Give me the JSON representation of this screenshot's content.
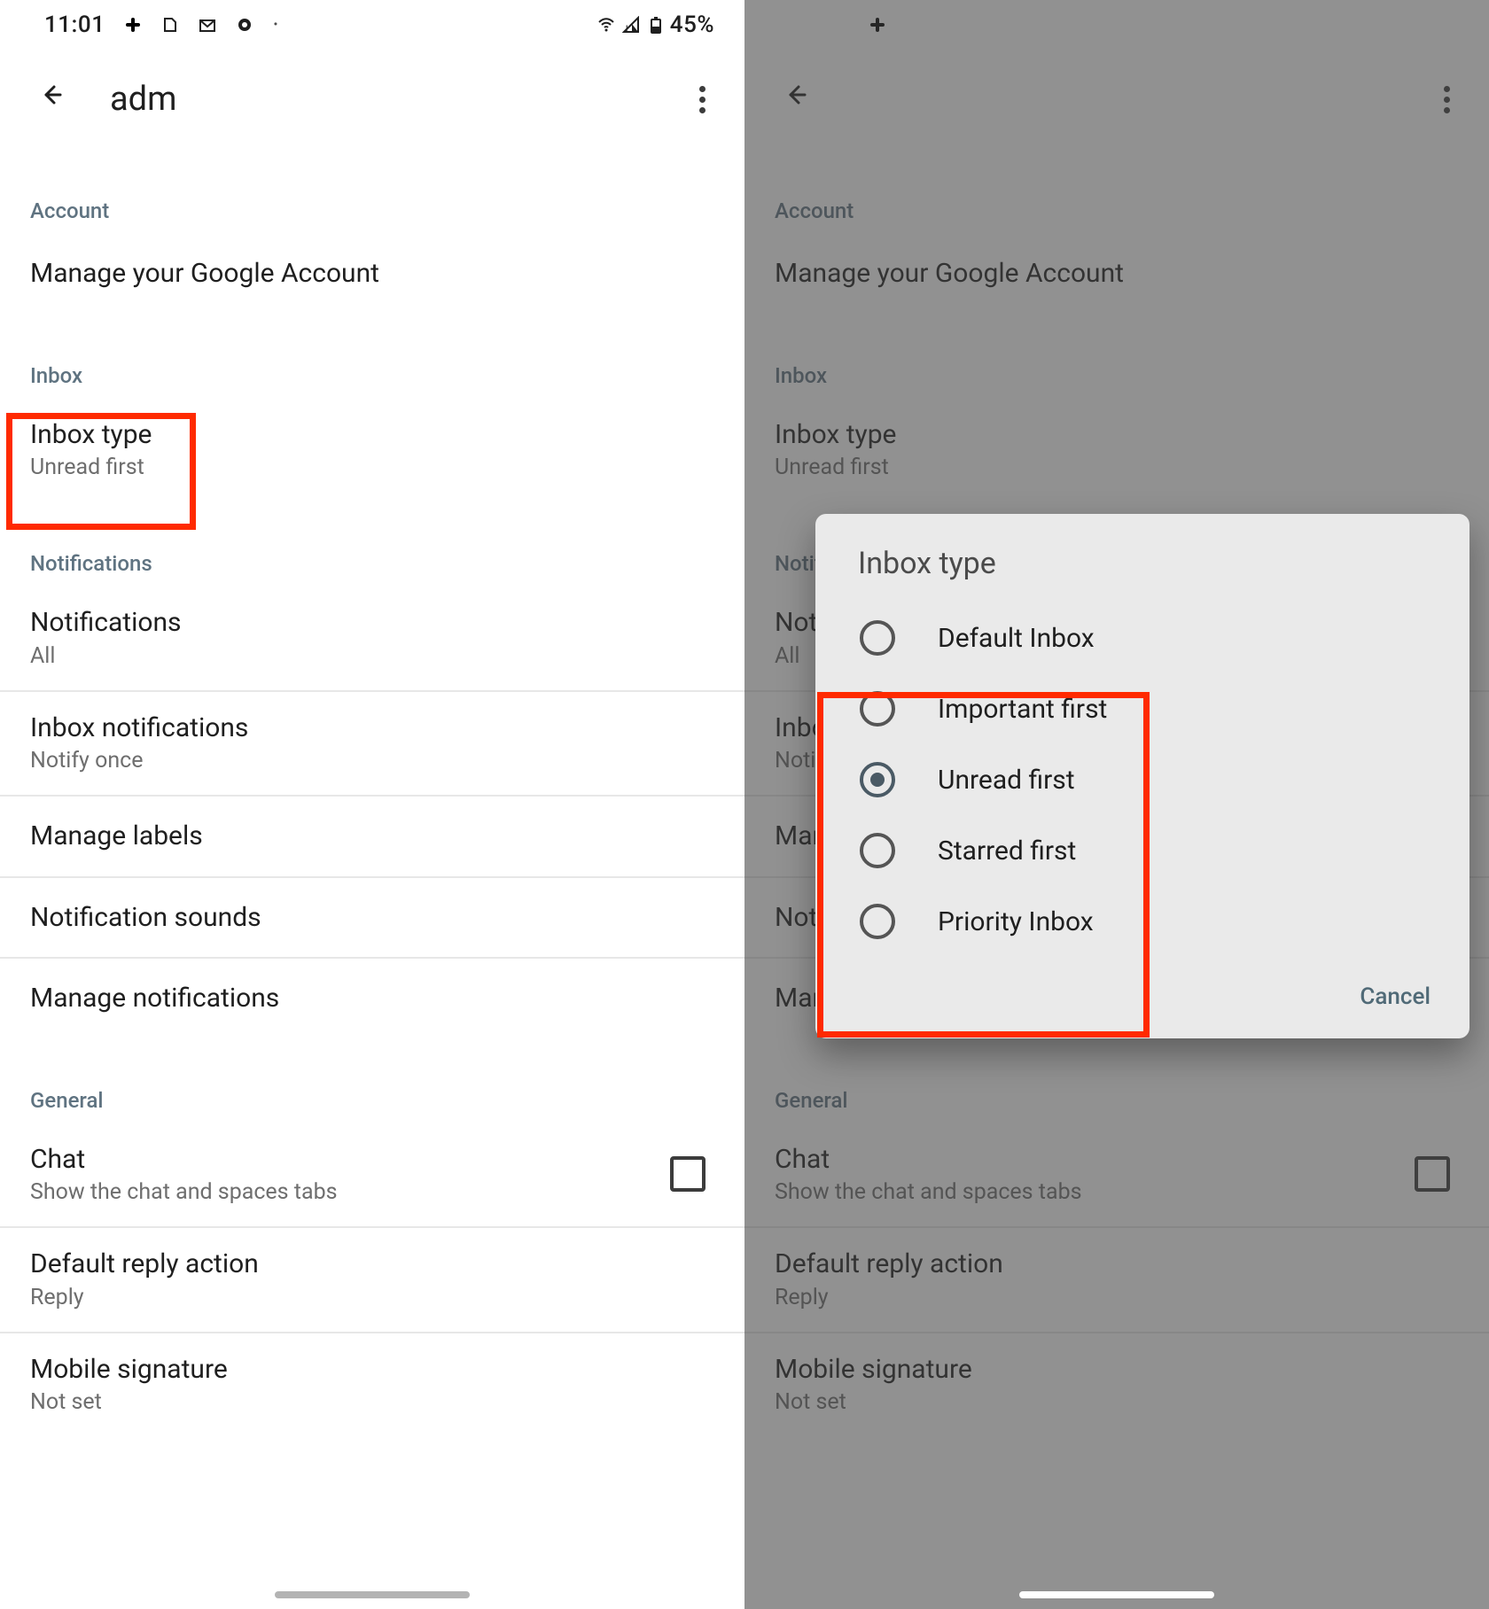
{
  "status": {
    "time": "11:01",
    "battery_pct": "45%",
    "icons": {
      "slack": "slack",
      "pitch": "pitch",
      "gmail": "gmail",
      "location": "location"
    }
  },
  "appbar": {
    "title": "adm"
  },
  "sections": {
    "account": {
      "header": "Account",
      "manage_google": "Manage your Google Account"
    },
    "inbox": {
      "header": "Inbox",
      "inbox_type": {
        "title": "Inbox type",
        "sub": "Unread first"
      }
    },
    "notifications": {
      "header": "Notifications",
      "notifications": {
        "title": "Notifications",
        "sub": "All"
      },
      "inbox_notifications": {
        "title": "Inbox notifications",
        "sub": "Notify once"
      },
      "manage_labels": {
        "title": "Manage labels"
      },
      "notification_sounds": {
        "title": "Notification sounds"
      },
      "manage_notifications": {
        "title": "Manage notifications"
      }
    },
    "general": {
      "header": "General",
      "chat": {
        "title": "Chat",
        "sub": "Show the chat and spaces tabs",
        "checked": false
      },
      "default_reply": {
        "title": "Default reply action",
        "sub": "Reply"
      },
      "mobile_signature": {
        "title": "Mobile signature",
        "sub": "Not set"
      }
    }
  },
  "dialog": {
    "title": "Inbox type",
    "options": [
      {
        "label": "Default Inbox",
        "selected": false
      },
      {
        "label": "Important first",
        "selected": false
      },
      {
        "label": "Unread first",
        "selected": true
      },
      {
        "label": "Starred first",
        "selected": false
      },
      {
        "label": "Priority Inbox",
        "selected": false
      }
    ],
    "cancel": "Cancel"
  }
}
